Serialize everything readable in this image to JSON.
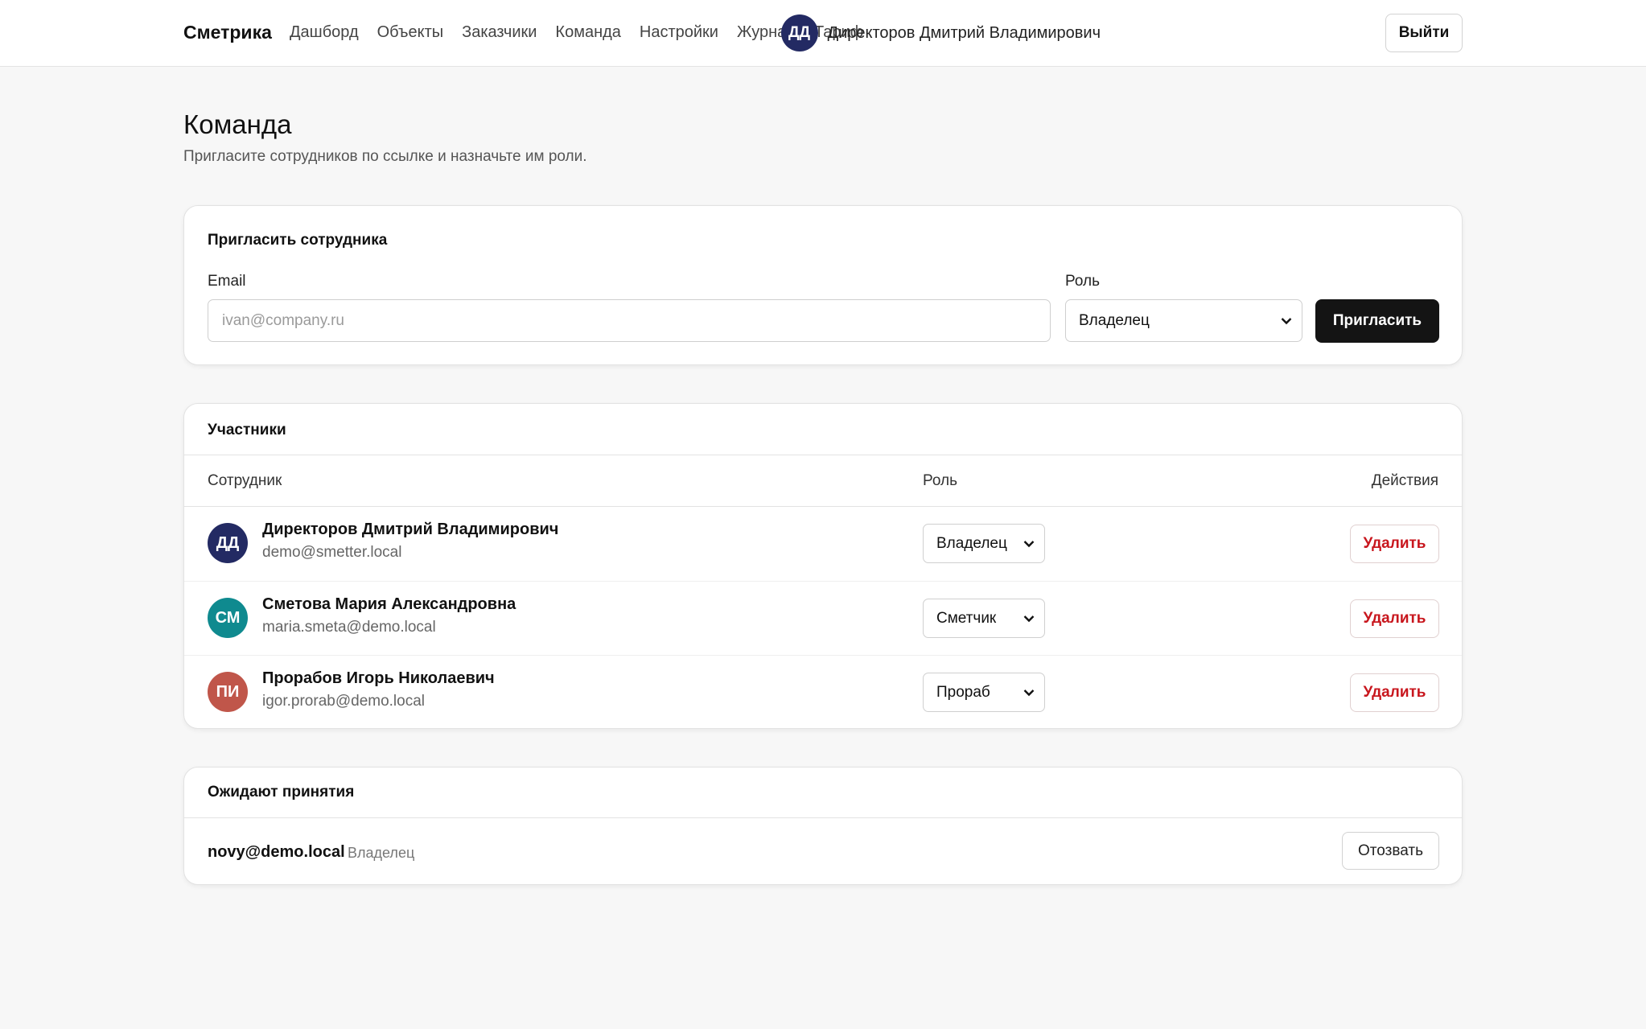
{
  "header": {
    "brand": "Сметрика",
    "nav": [
      "Дашборд",
      "Объекты",
      "Заказчики",
      "Команда",
      "Настройки",
      "Журнал",
      "Тариф"
    ],
    "user": {
      "initials": "ДД",
      "name": "Директоров Дмитрий Владимирович",
      "avatar_color": "#232a63"
    },
    "logout_label": "Выйти"
  },
  "page": {
    "title": "Команда",
    "subtitle": "Пригласите сотрудников по ссылке и назначьте им роли."
  },
  "invite": {
    "title": "Пригласить сотрудника",
    "email_label": "Email",
    "email_placeholder": "ivan@company.ru",
    "email_value": "",
    "role_label": "Роль",
    "role_value": "Владелец",
    "button_label": "Пригласить"
  },
  "members": {
    "title": "Участники",
    "columns": {
      "employee": "Сотрудник",
      "role": "Роль",
      "actions": "Действия"
    },
    "rows": [
      {
        "initials": "ДД",
        "name": "Директоров Дмитрий Владимирович",
        "email": "demo@smetter.local",
        "role": "Владелец",
        "avatar_color": "#232a63",
        "action": "Удалить"
      },
      {
        "initials": "СМ",
        "name": "Сметова Мария Александровна",
        "email": "maria.smeta@demo.local",
        "role": "Сметчик",
        "avatar_color": "#0f8a8f",
        "action": "Удалить"
      },
      {
        "initials": "ПИ",
        "name": "Прорабов Игорь Николаевич",
        "email": "igor.prorab@demo.local",
        "role": "Прораб",
        "avatar_color": "#c0564a",
        "action": "Удалить"
      }
    ]
  },
  "pending": {
    "title": "Ожидают принятия",
    "items": [
      {
        "email": "novy@demo.local",
        "role": "Владелец",
        "action": "Отозвать"
      }
    ]
  },
  "colors": {
    "accent_dark": "#141414",
    "danger": "#c8161d",
    "background": "#f7f7f7"
  },
  "icons": {
    "select_arrow": "chevron-down-icon"
  }
}
